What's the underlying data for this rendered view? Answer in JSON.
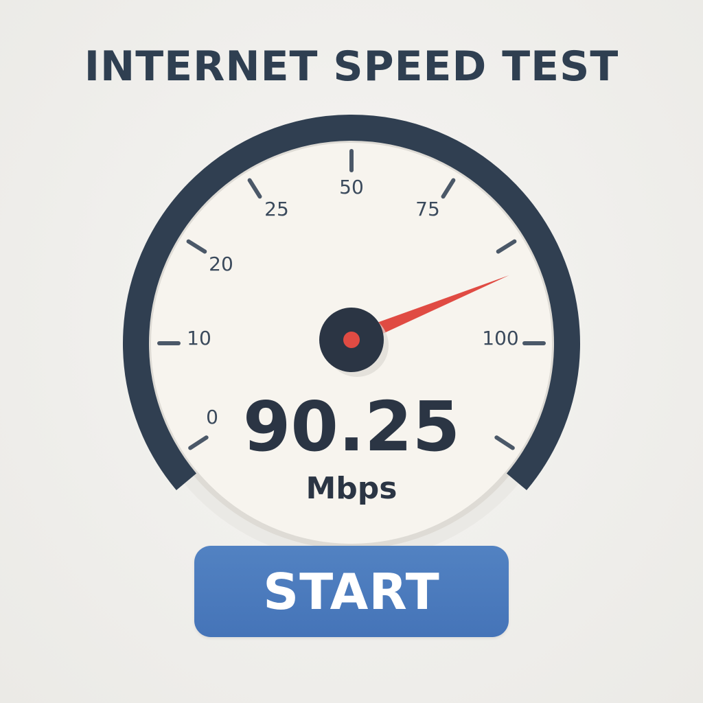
{
  "header": {
    "title": "INTERNET SPEED TEST"
  },
  "gauge": {
    "tick_labels": [
      "0",
      "10",
      "20",
      "25",
      "50",
      "75",
      "100"
    ],
    "needle_level": 0.9025,
    "colors": {
      "bezel": "#303f51",
      "face": "#f7f4ee",
      "needle": "#e04b43",
      "hub": "#2b3544",
      "ticks": "#4b5868"
    }
  },
  "reading": {
    "value": "90.25",
    "unit": "Mbps"
  },
  "controls": {
    "start_label": "START",
    "accent": "#4a78ba"
  }
}
